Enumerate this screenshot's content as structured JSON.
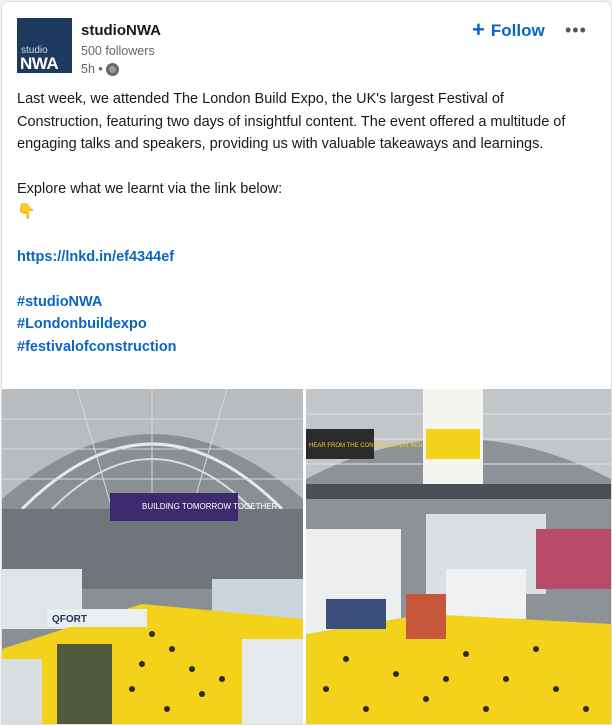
{
  "author": {
    "name": "studioNWA",
    "followers": "500 followers",
    "time": "5h •",
    "logo_small": "studio",
    "logo_big": "NWA"
  },
  "actions": {
    "follow_label": "Follow",
    "follow_icon": "+",
    "more_icon": "•••"
  },
  "post": {
    "paragraph1": "Last week, we attended The London Build Expo, the UK's largest Festival of Construction, featuring two days of insightful content. The event offered a multitude of engaging talks and speakers, providing us with valuable takeaways and learnings.",
    "paragraph2": "Explore what we learnt via the link below:",
    "emoji": "👇",
    "link": "https://lnkd.in/ef4344ef",
    "hashtags": [
      "#studioNWA",
      "#Londonbuildexpo",
      "#festivalofconstruction"
    ]
  },
  "images": {
    "left_banner": "BUILDING TOMORROW TOGETHER",
    "left_sign": "QFORT",
    "right_sign": "HEAR FROM THE CONSTRUCTION INDUSTRY"
  },
  "colors": {
    "link": "#0a66c2",
    "floor": "#f2d21b",
    "logo_bg": "#1f3a5f"
  }
}
